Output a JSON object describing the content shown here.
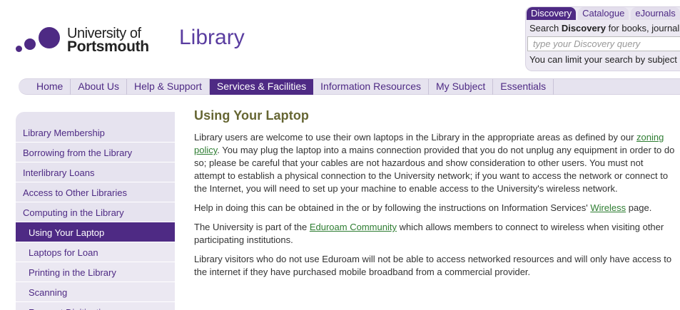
{
  "header": {
    "logo_line1": "University of",
    "logo_line2": "Portsmouth",
    "library_title": "Library"
  },
  "search": {
    "tabs": [
      "Discovery",
      "Catalogue",
      "eJournals"
    ],
    "desc_prefix": "Search ",
    "desc_bold": "Discovery",
    "desc_suffix": " for books, journal",
    "placeholder": "type your Discovery query",
    "limit_text": "You can limit your search by subject"
  },
  "nav": {
    "items": [
      "Home",
      "About Us",
      "Help & Support",
      "Services & Facilities",
      "Information Resources",
      "My Subject",
      "Essentials"
    ],
    "active": "Services & Facilities"
  },
  "sidebar": {
    "items": [
      "Library Membership",
      "Borrowing from the Library",
      "Interlibrary Loans",
      "Access to Other Libraries",
      "Computing in the Library",
      "Using Your Laptop",
      "Laptops for Loan",
      "Printing in the Library",
      "Scanning",
      "Request Digitisation"
    ],
    "active": "Using Your Laptop"
  },
  "content": {
    "title": "Using Your Laptop",
    "p1_a": "Library users are welcome to use their own laptops in the Library in the appropriate areas as defined by our ",
    "p1_link": "zoning policy",
    "p1_b": ". You may plug the laptop into a mains connection provided that you do not unplug any equipment in order to do so; please be careful that your cables are not hazardous and show consideration to other users. You must not attempt to establish a physical connection to the University network; if you want to access the network or connect to the Internet, you will need to set up your machine to enable access to the University's wireless network.",
    "p2_a": "Help in doing this can be obtained in the or by following the instructions on Information Services' ",
    "p2_link": "Wireless",
    "p2_b": " page.",
    "p3_a": "The University is part of the ",
    "p3_link": "Eduroam Community",
    "p3_b": " which allows members to connect to wireless when visiting other participating institutions.",
    "p4": "Library visitors who do not use Eduroam will not be able to access networked resources and will only have access to the internet if they have purchased mobile broadband from a commercial provider."
  },
  "colors": {
    "brand_purple": "#4e2a84",
    "title_olive": "#666633",
    "link_green": "#2e7d32",
    "nav_bg": "#e6e3ef"
  }
}
